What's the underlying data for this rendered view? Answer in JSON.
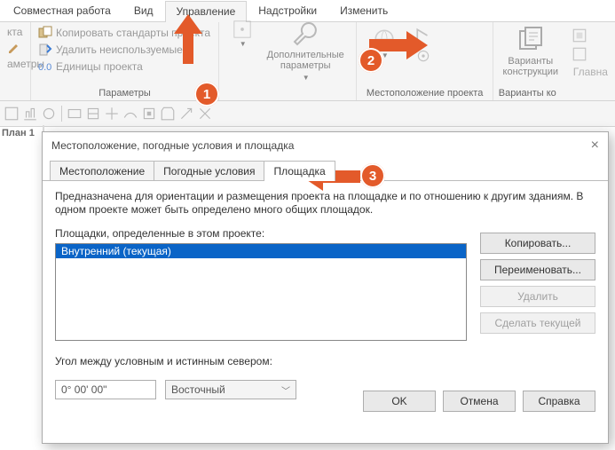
{
  "ribbon_tabs": {
    "t0": "Совместная работа",
    "t1": "Вид",
    "t2": "Управление",
    "t3": "Надстройки",
    "t4": "Изменить"
  },
  "grp1": {
    "r0": "кта",
    "r1": "Копировать стандарты проекта",
    "r2": "Удалить неиспользуемые",
    "r3": "Единицы проекта",
    "label_left": "аметры",
    "label": "Параметры"
  },
  "grp2": {
    "btn": "Дополнительные параметры",
    "label": ""
  },
  "grp3": {
    "label": "Местоположение проекта"
  },
  "grp4": {
    "btn": "Варианты конструкции",
    "label_right": "Главна",
    "label": "Варианты ко"
  },
  "left_panel": "План 1",
  "dialog": {
    "title": "Местоположение, погодные условия и площадка",
    "tabs": {
      "t0": "Местоположение",
      "t1": "Погодные условия",
      "t2": "Площадка"
    },
    "desc": "Предназначена для ориентации и размещения проекта на площадке и по отношению к другим зданиям. В одном проекте может быть определено много общих площадок.",
    "listLabel": "Площадки, определенные в этом проекте:",
    "listItem": "Внутренний (текущая)",
    "sideButtons": {
      "copy": "Копировать...",
      "rename": "Переименовать...",
      "delete": "Удалить",
      "current": "Сделать текущей"
    },
    "angleLabel": "Угол между условным и истинным севером:",
    "angleValue": "0° 00' 00\"",
    "orient": "Восточный",
    "footer": {
      "ok": "OK",
      "cancel": "Отмена",
      "help": "Справка"
    }
  },
  "annotations": {
    "a1": "1",
    "a2": "2",
    "a3": "3"
  }
}
